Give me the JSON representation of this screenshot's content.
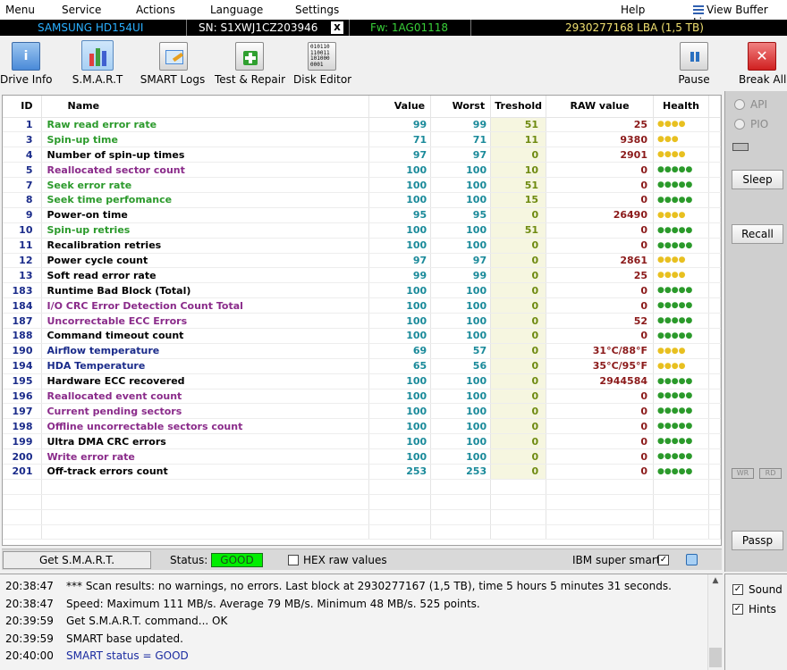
{
  "menu": {
    "items": [
      "Menu",
      "Service",
      "Actions",
      "Language",
      "Settings",
      "Help"
    ],
    "view_buffer": "View Buffer Live"
  },
  "drive": {
    "model": "SAMSUNG HD154UI",
    "serial": "SN: S1XWJ1CZ203946",
    "close": "x",
    "firmware": "Fw: 1AG01118",
    "capacity": "2930277168 LBA (1,5 TB)"
  },
  "toolbar": {
    "drive_info": "Drive Info",
    "smart": "S.M.A.R.T",
    "smart_logs": "SMART Logs",
    "test_repair": "Test & Repair",
    "disk_editor": "Disk Editor",
    "disk_editor_icon_text": "010110\n110011\n101000\n0001",
    "pause": "Pause",
    "break_all": "Break All"
  },
  "table": {
    "headers": [
      "ID",
      "Name",
      "Value",
      "Worst",
      "Treshold",
      "RAW value",
      "Health"
    ],
    "rows": [
      {
        "id": "1",
        "name": "Raw read error rate",
        "value": "99",
        "worst": "99",
        "thresh": "51",
        "raw": "25",
        "health": 4,
        "color": "green"
      },
      {
        "id": "3",
        "name": "Spin-up time",
        "value": "71",
        "worst": "71",
        "thresh": "11",
        "raw": "9380",
        "health": 3,
        "color": "green"
      },
      {
        "id": "4",
        "name": "Number of spin-up times",
        "value": "97",
        "worst": "97",
        "thresh": "0",
        "raw": "2901",
        "health": 4,
        "color": "black"
      },
      {
        "id": "5",
        "name": "Reallocated sector count",
        "value": "100",
        "worst": "100",
        "thresh": "10",
        "raw": "0",
        "health": 5,
        "color": "purple"
      },
      {
        "id": "7",
        "name": "Seek error rate",
        "value": "100",
        "worst": "100",
        "thresh": "51",
        "raw": "0",
        "health": 5,
        "color": "green"
      },
      {
        "id": "8",
        "name": "Seek time perfomance",
        "value": "100",
        "worst": "100",
        "thresh": "15",
        "raw": "0",
        "health": 5,
        "color": "green"
      },
      {
        "id": "9",
        "name": "Power-on time",
        "value": "95",
        "worst": "95",
        "thresh": "0",
        "raw": "26490",
        "health": 4,
        "color": "black"
      },
      {
        "id": "10",
        "name": "Spin-up retries",
        "value": "100",
        "worst": "100",
        "thresh": "51",
        "raw": "0",
        "health": 5,
        "color": "green"
      },
      {
        "id": "11",
        "name": "Recalibration retries",
        "value": "100",
        "worst": "100",
        "thresh": "0",
        "raw": "0",
        "health": 5,
        "color": "black"
      },
      {
        "id": "12",
        "name": "Power cycle count",
        "value": "97",
        "worst": "97",
        "thresh": "0",
        "raw": "2861",
        "health": 4,
        "color": "black"
      },
      {
        "id": "13",
        "name": "Soft read error rate",
        "value": "99",
        "worst": "99",
        "thresh": "0",
        "raw": "25",
        "health": 4,
        "color": "black"
      },
      {
        "id": "183",
        "name": "Runtime Bad Block (Total)",
        "value": "100",
        "worst": "100",
        "thresh": "0",
        "raw": "0",
        "health": 5,
        "color": "black"
      },
      {
        "id": "184",
        "name": "I/O CRC Error Detection Count Total",
        "value": "100",
        "worst": "100",
        "thresh": "0",
        "raw": "0",
        "health": 5,
        "color": "purple"
      },
      {
        "id": "187",
        "name": "Uncorrectable ECC Errors",
        "value": "100",
        "worst": "100",
        "thresh": "0",
        "raw": "52",
        "health": 5,
        "color": "purple"
      },
      {
        "id": "188",
        "name": "Command timeout count",
        "value": "100",
        "worst": "100",
        "thresh": "0",
        "raw": "0",
        "health": 5,
        "color": "black"
      },
      {
        "id": "190",
        "name": "Airflow temperature",
        "value": "69",
        "worst": "57",
        "thresh": "0",
        "raw": "31°C/88°F",
        "health": 4,
        "color": "navy"
      },
      {
        "id": "194",
        "name": "HDA Temperature",
        "value": "65",
        "worst": "56",
        "thresh": "0",
        "raw": "35°C/95°F",
        "health": 4,
        "color": "navy"
      },
      {
        "id": "195",
        "name": "Hardware ECC recovered",
        "value": "100",
        "worst": "100",
        "thresh": "0",
        "raw": "2944584",
        "health": 5,
        "color": "black"
      },
      {
        "id": "196",
        "name": "Reallocated event count",
        "value": "100",
        "worst": "100",
        "thresh": "0",
        "raw": "0",
        "health": 5,
        "color": "purple"
      },
      {
        "id": "197",
        "name": "Current pending sectors",
        "value": "100",
        "worst": "100",
        "thresh": "0",
        "raw": "0",
        "health": 5,
        "color": "purple"
      },
      {
        "id": "198",
        "name": "Offline uncorrectable sectors count",
        "value": "100",
        "worst": "100",
        "thresh": "0",
        "raw": "0",
        "health": 5,
        "color": "purple"
      },
      {
        "id": "199",
        "name": "Ultra DMA CRC errors",
        "value": "100",
        "worst": "100",
        "thresh": "0",
        "raw": "0",
        "health": 5,
        "color": "black"
      },
      {
        "id": "200",
        "name": "Write error rate",
        "value": "100",
        "worst": "100",
        "thresh": "0",
        "raw": "0",
        "health": 5,
        "color": "purple"
      },
      {
        "id": "201",
        "name": "Off-track errors count",
        "value": "253",
        "worst": "253",
        "thresh": "0",
        "raw": "0",
        "health": 5,
        "color": "black"
      }
    ]
  },
  "side": {
    "api": "API",
    "pio": "PIO",
    "sleep": "Sleep",
    "recall": "Recall",
    "wr": "WR",
    "rd": "RD",
    "passp": "Passp"
  },
  "status": {
    "get_smart": "Get S.M.A.R.T.",
    "label": "Status:",
    "value": "GOOD",
    "hex_raw": "HEX raw values",
    "ibm": "IBM super smart:"
  },
  "log": [
    {
      "time": "20:38:47",
      "text": "*** Scan results: no warnings, no errors. Last block at 2930277167 (1,5 TB), time 5 hours 5 minutes 31 seconds.",
      "color": "#000000"
    },
    {
      "time": "20:38:47",
      "text": "Speed: Maximum 111 MB/s. Average 79 MB/s. Minimum 48 MB/s. 525 points.",
      "color": "#000000"
    },
    {
      "time": "20:39:59",
      "text": "Get S.M.A.R.T. command... OK",
      "color": "#000000"
    },
    {
      "time": "20:39:59",
      "text": "SMART base updated.",
      "color": "#000000"
    },
    {
      "time": "20:40:00",
      "text": "SMART status = GOOD",
      "color": "#1a2ba0"
    }
  ],
  "options": {
    "sound": "Sound",
    "hints": "Hints"
  },
  "colors": {
    "status_good_bg": "#00ee00",
    "health_dot": "#e8c020",
    "health_dot_full": "#2b9a2b"
  }
}
